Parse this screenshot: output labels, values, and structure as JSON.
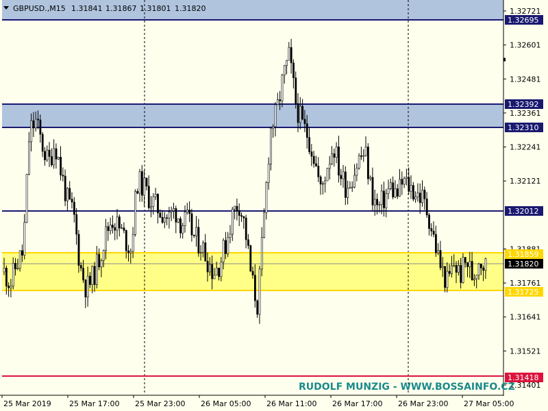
{
  "header": {
    "symbol": "GBPUSD.,M15",
    "open": "1.31841",
    "high": "1.31867",
    "low": "1.31801",
    "close": "1.31820"
  },
  "watermark": "RUDOLF MUNZIG - WWW.BOSSAINFO.CZ",
  "colors": {
    "background": "#ffffee",
    "blue_zone": "#b0c4de",
    "yellow_zone": "#ffff88",
    "line_navy": "#191970",
    "line_red": "#dc143c",
    "line_gold": "#ffd700",
    "candle": "#000000",
    "watermark": "#1a8a8a"
  },
  "chart_data": {
    "type": "candlestick",
    "ylim": [
      1.3136,
      1.3276
    ],
    "y_ticks": [
      "1.32721",
      "1.32601",
      "1.32481",
      "1.32361",
      "1.32241",
      "1.32121",
      "1.31881",
      "1.31761",
      "1.31641",
      "1.31521",
      "1.31401"
    ],
    "x_ticks": [
      "25 Mar 2019",
      "25 Mar 17:00",
      "25 Mar 23:00",
      "26 Mar 05:00",
      "26 Mar 11:00",
      "26 Mar 17:00",
      "26 Mar 23:00",
      "27 Mar 05:00"
    ],
    "zones": [
      {
        "top": 1.32721,
        "bottom": 1.32695,
        "color": "blue"
      },
      {
        "top": 1.32392,
        "bottom": 1.3231,
        "color": "blue"
      },
      {
        "top": 1.31859,
        "bottom": 1.31725,
        "color": "yellow"
      }
    ],
    "levels": [
      {
        "value": "1.32695",
        "color": "navy"
      },
      {
        "value": "1.32392",
        "color": "navy"
      },
      {
        "value": "1.32310",
        "color": "navy"
      },
      {
        "value": "1.32012",
        "color": "navy"
      },
      {
        "value": "1.31859",
        "color": "gold"
      },
      {
        "value": "1.31820",
        "color": "black",
        "current": true
      },
      {
        "value": "1.31725",
        "color": "gold"
      },
      {
        "value": "1.31418",
        "color": "red"
      }
    ],
    "period_separators": [
      "25 Mar 23:00",
      "26 Mar 23:00"
    ],
    "close_path": [
      [
        0,
        1.318
      ],
      [
        1,
        1.3176
      ],
      [
        2,
        1.3183
      ],
      [
        3,
        1.3187
      ],
      [
        4,
        1.323
      ],
      [
        5,
        1.3233
      ],
      [
        6,
        1.3225
      ],
      [
        7,
        1.3218
      ],
      [
        8,
        1.3226
      ],
      [
        9,
        1.3215
      ],
      [
        10,
        1.3205
      ],
      [
        11,
        1.32
      ],
      [
        12,
        1.3182
      ],
      [
        13,
        1.3174
      ],
      [
        14,
        1.3178
      ],
      [
        15,
        1.3185
      ],
      [
        16,
        1.3193
      ],
      [
        17,
        1.3199
      ],
      [
        18,
        1.3196
      ],
      [
        19,
        1.3192
      ],
      [
        20,
        1.3188
      ],
      [
        21,
        1.3212
      ],
      [
        22,
        1.321
      ],
      [
        23,
        1.3206
      ],
      [
        24,
        1.3203
      ],
      [
        25,
        1.3201
      ],
      [
        26,
        1.3199
      ],
      [
        27,
        1.3202
      ],
      [
        28,
        1.3197
      ],
      [
        29,
        1.3198
      ],
      [
        30,
        1.3192
      ],
      [
        31,
        1.319
      ],
      [
        32,
        1.3185
      ],
      [
        33,
        1.318
      ],
      [
        34,
        1.3183
      ],
      [
        35,
        1.319
      ],
      [
        36,
        1.32
      ],
      [
        37,
        1.3205
      ],
      [
        38,
        1.3196
      ],
      [
        39,
        1.3178
      ],
      [
        40,
        1.3168
      ],
      [
        41,
        1.3198
      ],
      [
        42,
        1.323
      ],
      [
        43,
        1.3236
      ],
      [
        44,
        1.3248
      ],
      [
        45,
        1.3256
      ],
      [
        46,
        1.324
      ],
      [
        47,
        1.3232
      ],
      [
        48,
        1.3228
      ],
      [
        49,
        1.322
      ],
      [
        50,
        1.3208
      ],
      [
        51,
        1.3218
      ],
      [
        52,
        1.3225
      ],
      [
        53,
        1.3215
      ],
      [
        54,
        1.321
      ],
      [
        55,
        1.3214
      ],
      [
        56,
        1.322
      ],
      [
        57,
        1.3222
      ],
      [
        58,
        1.3208
      ],
      [
        59,
        1.3202
      ],
      [
        60,
        1.3206
      ],
      [
        61,
        1.321
      ],
      [
        62,
        1.3207
      ],
      [
        63,
        1.3212
      ],
      [
        64,
        1.321
      ],
      [
        65,
        1.3208
      ],
      [
        66,
        1.3206
      ],
      [
        67,
        1.32
      ],
      [
        68,
        1.319
      ],
      [
        69,
        1.3181
      ],
      [
        70,
        1.3176
      ],
      [
        71,
        1.3183
      ],
      [
        72,
        1.3179
      ],
      [
        73,
        1.3184
      ],
      [
        74,
        1.3178
      ],
      [
        75,
        1.3185
      ],
      [
        76,
        1.3182
      ]
    ]
  }
}
